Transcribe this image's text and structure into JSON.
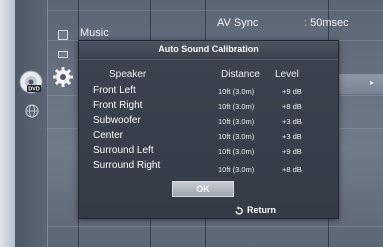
{
  "background": {
    "music_label": "Music",
    "av_sync_label": "AV Sync",
    "av_sync_value": ": 50msec"
  },
  "dialog": {
    "title": "Auto Sound Calibration",
    "headers": {
      "speaker": "Speaker",
      "distance": "Distance",
      "level": "Level"
    },
    "rows": [
      {
        "speaker": "Front Left",
        "distance": "10ft (3.0m)",
        "level": "+9 dB"
      },
      {
        "speaker": "Front Right",
        "distance": "10ft (3.0m)",
        "level": "+8 dB"
      },
      {
        "speaker": "Subwoofer",
        "distance": "10ft (3.0m)",
        "level": "+3 dB"
      },
      {
        "speaker": "Center",
        "distance": "10ft (3.0m)",
        "level": "+3 dB"
      },
      {
        "speaker": "Surround Left",
        "distance": "10ft (3.0m)",
        "level": "+9 dB"
      },
      {
        "speaker": "Surround Right",
        "distance": "10ft (3.0m)",
        "level": "+8 dB"
      }
    ],
    "ok_label": "OK",
    "return_label": "Return"
  },
  "icons": {
    "disc": "disc-dvd-icon",
    "gear": "gear-icon",
    "globe": "globe-icon",
    "return": "return-icon"
  }
}
